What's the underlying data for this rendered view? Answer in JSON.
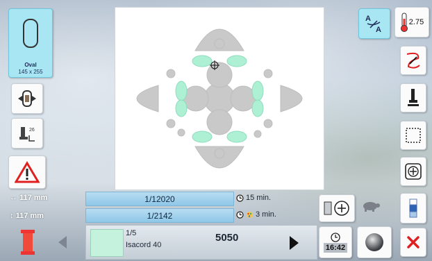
{
  "hoop": {
    "name": "Oval",
    "dims": "145 x 255"
  },
  "top_right": {
    "thickness_value": "2.75"
  },
  "info": {
    "width_value": "117 mm",
    "height_value": "117 mm"
  },
  "progress": {
    "stitch_counter": "1/12020",
    "color_counter": "1/2142",
    "total_time": "15 min.",
    "color_time": "3 min."
  },
  "thread": {
    "index": "1/5",
    "name": "Isacord 40",
    "number": "5050",
    "swatch_color": "#c4f2dc"
  },
  "clock": {
    "time": "16:42"
  }
}
